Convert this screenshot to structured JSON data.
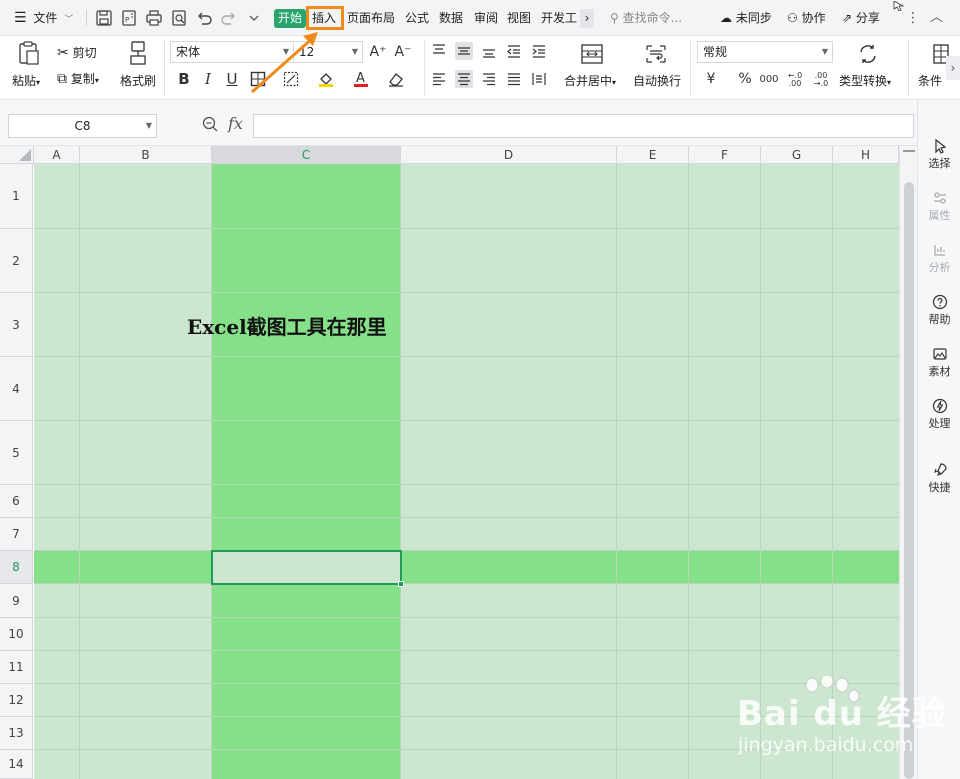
{
  "topbar": {
    "menu_label": "文件",
    "tabs": [
      {
        "label": "开始"
      },
      {
        "label": "插入"
      },
      {
        "label": "页面布局"
      },
      {
        "label": "公式"
      },
      {
        "label": "数据"
      },
      {
        "label": "审阅"
      },
      {
        "label": "视图"
      },
      {
        "label": "开发工"
      }
    ],
    "more_tabs_glyph": "›",
    "search_placeholder": "查找命令...",
    "sync_label": "未同步",
    "collab_label": "协作",
    "share_label": "分享",
    "more_glyph": "⋮",
    "collapse_glyph": "︿"
  },
  "ribbon": {
    "paste_label": "粘贴",
    "cut_label": "剪切",
    "copy_label": "复制",
    "format_painter_label": "格式刷",
    "font_name": "宋体",
    "font_size": "12",
    "grow_font": "A⁺",
    "shrink_font": "A⁻",
    "bold": "B",
    "italic": "I",
    "underline": "U",
    "merge_label": "合并居中",
    "wrap_label": "自动换行",
    "number_format": "常规",
    "currency": "¥",
    "percent": "%",
    "thousands": "000",
    "inc_decimal": "←.0\n.00",
    "dec_decimal": ".00\n→.0",
    "type_convert_label": "类型转换",
    "cond_format_label": "条件",
    "more_glyph": "›"
  },
  "formula_bar": {
    "name_box": "C8",
    "fx_label": "fx",
    "value": ""
  },
  "grid": {
    "columns": [
      "A",
      "B",
      "C",
      "D",
      "E",
      "F",
      "G",
      "H"
    ],
    "rows": [
      "1",
      "2",
      "3",
      "4",
      "5",
      "6",
      "7",
      "8",
      "9",
      "10",
      "11",
      "12",
      "13",
      "14"
    ],
    "selected_column": "C",
    "selected_row": "8",
    "sheet_text": "Excel截图工具在那里"
  },
  "right_panel": {
    "items": [
      {
        "label": "选择"
      },
      {
        "label": "属性"
      },
      {
        "label": "分析"
      },
      {
        "label": "帮助"
      },
      {
        "label": "素材"
      },
      {
        "label": "处理"
      },
      {
        "label": "快捷"
      }
    ]
  },
  "watermark": {
    "brand": "Bai du 经验",
    "url": "jingyan.baidu.com"
  },
  "colors": {
    "accent": "#27a56b",
    "cell_fill": "#cce6cf",
    "highlight_fill": "#86e08a",
    "annotation": "#f08a1a"
  }
}
